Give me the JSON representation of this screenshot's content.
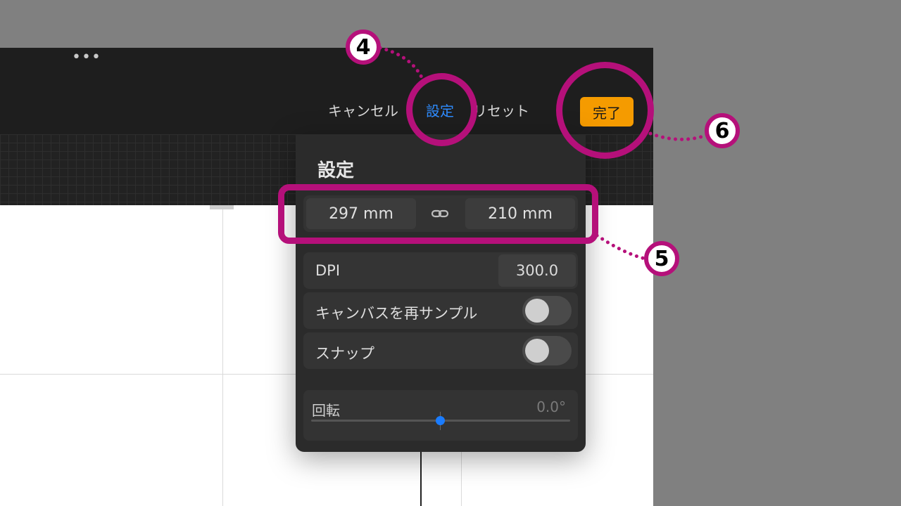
{
  "toolbar": {
    "more_icon": "ellipsis-icon",
    "more_glyph": "•••",
    "cancel_label": "キャンセル",
    "settings_label": "設定",
    "reset_label": "リセット",
    "done_label": "完了"
  },
  "settings_panel": {
    "title": "設定",
    "width_value": "297 mm",
    "height_value": "210 mm",
    "link_icon": "chain-link-icon",
    "dpi_label": "DPI",
    "dpi_value": "300.0",
    "resample_label": "キャンバスを再サンプル",
    "resample_on": false,
    "snap_label": "スナップ",
    "snap_on": false,
    "rotation_label": "回転",
    "rotation_value": "0.0°",
    "rotation_fraction": 0.5
  },
  "annotations": {
    "step4": "4",
    "step5": "5",
    "step6": "6"
  },
  "colors": {
    "accent_blue": "#2f8cff",
    "done_orange": "#f59b00",
    "annotation_magenta": "#b5107a",
    "panel_bg": "#2b2b2b"
  }
}
